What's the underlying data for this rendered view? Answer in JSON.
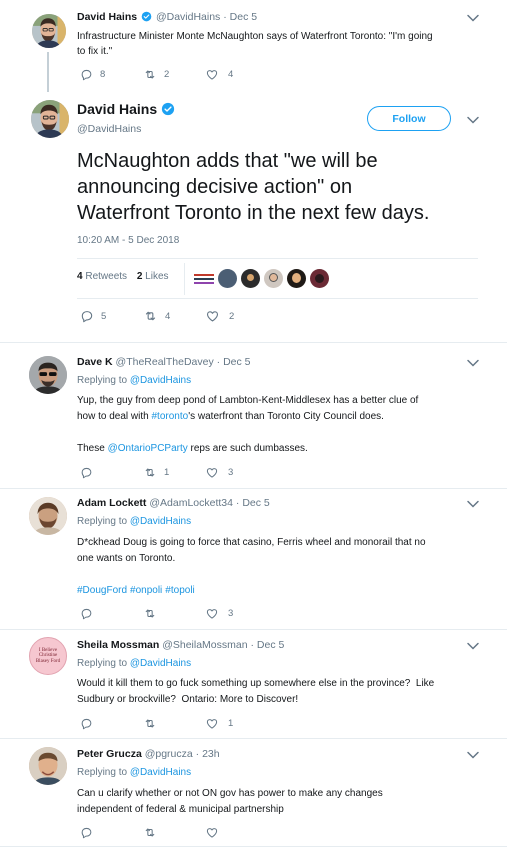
{
  "parent": {
    "name": "David Hains",
    "handle": "@DavidHains",
    "sep": "·",
    "date": "Dec 5",
    "text_l1": "Infrastructure Minister Monte McNaughton says of Waterfront Toronto: \"I'm going",
    "text_l2": "to fix it.\"",
    "replies": "8",
    "retweets": "2",
    "likes": "4"
  },
  "main": {
    "name": "David Hains",
    "handle": "@DavidHains",
    "follow_label": "Follow",
    "text_l1": "McNaughton adds that \"we will be",
    "text_l2": "announcing decisive action\" on",
    "text_l3": "Waterfront Toronto in the next few days.",
    "timestamp": "10:20 AM - 5 Dec 2018",
    "retweets_count": "4",
    "retweets_label": "Retweets",
    "likes_count": "2",
    "likes_label": "Likes",
    "replies": "5",
    "retweets": "4",
    "likes": "2"
  },
  "replies": [
    {
      "name": "Dave K",
      "handle": "@TheRealTheDavey",
      "sep": "·",
      "date": "Dec 5",
      "replying_prefix": "Replying to",
      "replying_to": "@DavidHains",
      "l1": "Yup, the guy from deep pond of Lambton-Kent-Middlesex has a better clue of",
      "l2_a": "how to deal with ",
      "l2_tag": "#toronto",
      "l2_b": "'s waterfront than Toronto City Council does.",
      "l3_a": "These ",
      "l3_mention": "@OntarioPCParty",
      "l3_b": " reps are such dumbasses.",
      "replies": "",
      "retweets": "1",
      "likes": "3"
    },
    {
      "name": "Adam Lockett",
      "handle": "@AdamLockett34",
      "sep": "·",
      "date": "Dec 5",
      "replying_prefix": "Replying to",
      "replying_to": "@DavidHains",
      "l1": "D*ckhead Doug is going to force that casino, Ferris wheel and monorail that no",
      "l2": "one wants on Toronto.",
      "tag1": "#DougFord",
      "tag2": "#onpoli",
      "tag3": "#topoli",
      "replies": "",
      "retweets": "",
      "likes": "3"
    },
    {
      "name": "Sheila Mossman",
      "handle": "@SheilaMossman",
      "sep": "·",
      "date": "Dec 5",
      "replying_prefix": "Replying to",
      "replying_to": "@DavidHains",
      "l1": "Would it kill them to go fuck something up somewhere else in the province?  Like",
      "l2": "Sudbury or brockville?  Ontario: More to Discover!",
      "badge_text": "I Believe Christine Blasey Ford",
      "replies": "",
      "retweets": "",
      "likes": "1"
    },
    {
      "name": "Peter Grucza",
      "handle": "@pgrucza",
      "sep": "·",
      "date": "23h",
      "replying_prefix": "Replying to",
      "replying_to": "@DavidHains",
      "l1": "Can u clarify whether or not ON gov has power to make any changes",
      "l2": "independent of federal & municipal partnership",
      "replies": "",
      "retweets": "",
      "likes": ""
    }
  ],
  "colors": {
    "link": "#1b95e0",
    "verified": "#1da1f2",
    "muted": "#657786",
    "divider": "#e6ecf0"
  }
}
